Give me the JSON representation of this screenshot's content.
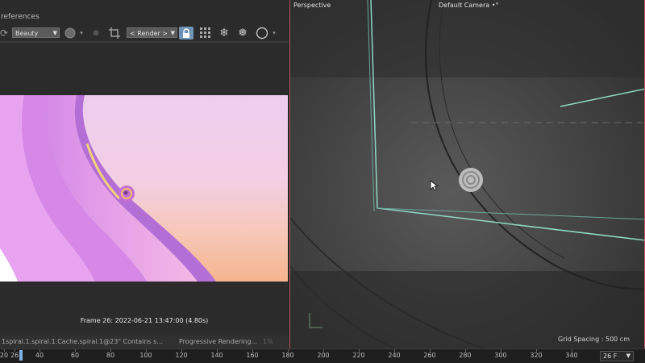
{
  "left_panel": {
    "menu_text": "references",
    "toolbar": {
      "channel_dropdown": "Beauty",
      "render_dropdown": "< Render >"
    },
    "frame_info": "Frame  26:  2022-06-21  13:47:00  (4.80s)",
    "status": {
      "file_text": "1spiral.1.spiral.1.Cache.spiral.1@23\" Contains s...",
      "progress_text": "Progressive Rendering...",
      "percent_text": "1%"
    }
  },
  "viewport": {
    "view_label": "Perspective",
    "camera_label": "Default Camera",
    "camera_suffix": "•°",
    "grid_spacing": "Grid Spacing : 500 cm"
  },
  "timeline": {
    "ticks": [
      "20",
      "26",
      "40",
      "60",
      "80",
      "100",
      "120",
      "140",
      "160",
      "180",
      "200",
      "220",
      "240",
      "260",
      "280",
      "300",
      "320",
      "340"
    ],
    "current_frame": "26 F"
  },
  "colors": {
    "accent_blue": "#6f93b5",
    "viewport_border": "#b45a66",
    "camera_frame": "#8fd8c4"
  }
}
